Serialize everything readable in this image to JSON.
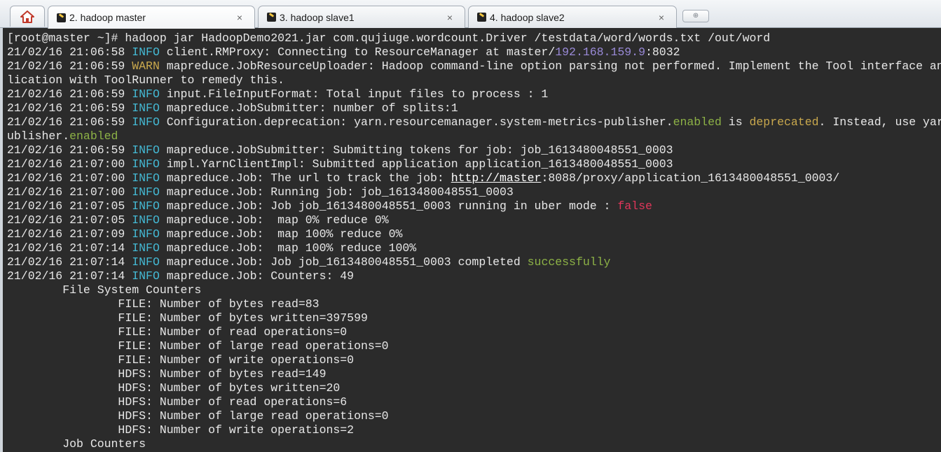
{
  "tabs": [
    {
      "label": "2. hadoop master",
      "active": true,
      "close": "×"
    },
    {
      "label": "3. hadoop slave1",
      "active": false,
      "close": "×"
    },
    {
      "label": "4. hadoop slave2",
      "active": false,
      "close": "×"
    }
  ],
  "new_tab_symbol": "⊕",
  "colors": {
    "background": "#2b2b2b",
    "text": "#e8e8e8",
    "info": "#44b9d4",
    "warn": "#c9a84d",
    "ip": "#9a8ad8",
    "highlight_green": "#8db246",
    "highlight_red": "#e0365a"
  },
  "terminal": {
    "lines": [
      [
        {
          "t": "[root@master ~]# hadoop jar HadoopDemo2021.jar com.qujiuge.wordcount.Driver /testdata/word/words.txt /out/word"
        }
      ],
      [
        {
          "t": "21/02/16 21:06:58 "
        },
        {
          "t": "INFO",
          "c": "info"
        },
        {
          "t": " client.RMProxy: Connecting to ResourceManager at master/"
        },
        {
          "t": "192.168.159.9",
          "c": "ip"
        },
        {
          "t": ":8032"
        }
      ],
      [
        {
          "t": "21/02/16 21:06:59 "
        },
        {
          "t": "WARN",
          "c": "warn"
        },
        {
          "t": " mapreduce.JobResourceUploader: Hadoop command-line option parsing not performed. Implement the Tool interface and execute your app"
        }
      ],
      [
        {
          "t": "lication with ToolRunner to remedy this."
        }
      ],
      [
        {
          "t": "21/02/16 21:06:59 "
        },
        {
          "t": "INFO",
          "c": "info"
        },
        {
          "t": " input.FileInputFormat: Total input files to process : 1"
        }
      ],
      [
        {
          "t": "21/02/16 21:06:59 "
        },
        {
          "t": "INFO",
          "c": "info"
        },
        {
          "t": " mapreduce.JobSubmitter: number of splits:1"
        }
      ],
      [
        {
          "t": "21/02/16 21:06:59 "
        },
        {
          "t": "INFO",
          "c": "info"
        },
        {
          "t": " Configuration.deprecation: yarn.resourcemanager.system-metrics-publisher."
        },
        {
          "t": "enabled",
          "c": "green"
        },
        {
          "t": " is "
        },
        {
          "t": "deprecated",
          "c": "warn"
        },
        {
          "t": ". Instead, use yarn.system-metrics-p"
        }
      ],
      [
        {
          "t": "ublisher."
        },
        {
          "t": "enabled",
          "c": "green"
        }
      ],
      [
        {
          "t": "21/02/16 21:06:59 "
        },
        {
          "t": "INFO",
          "c": "info"
        },
        {
          "t": " mapreduce.JobSubmitter: Submitting tokens for job: job_1613480048551_0003"
        }
      ],
      [
        {
          "t": "21/02/16 21:07:00 "
        },
        {
          "t": "INFO",
          "c": "info"
        },
        {
          "t": " impl.YarnClientImpl: Submitted application application_1613480048551_0003"
        }
      ],
      [
        {
          "t": "21/02/16 21:07:00 "
        },
        {
          "t": "INFO",
          "c": "info"
        },
        {
          "t": " mapreduce.Job: The url to track the job: "
        },
        {
          "t": "http://master",
          "c": "link"
        },
        {
          "t": ":8088/proxy/application_1613480048551_0003/"
        }
      ],
      [
        {
          "t": "21/02/16 21:07:00 "
        },
        {
          "t": "INFO",
          "c": "info"
        },
        {
          "t": " mapreduce.Job: Running job: job_1613480048551_0003"
        }
      ],
      [
        {
          "t": "21/02/16 21:07:05 "
        },
        {
          "t": "INFO",
          "c": "info"
        },
        {
          "t": " mapreduce.Job: Job job_1613480048551_0003 running in uber mode : "
        },
        {
          "t": "false",
          "c": "red"
        }
      ],
      [
        {
          "t": "21/02/16 21:07:05 "
        },
        {
          "t": "INFO",
          "c": "info"
        },
        {
          "t": " mapreduce.Job:  map 0% reduce 0%"
        }
      ],
      [
        {
          "t": "21/02/16 21:07:09 "
        },
        {
          "t": "INFO",
          "c": "info"
        },
        {
          "t": " mapreduce.Job:  map 100% reduce 0%"
        }
      ],
      [
        {
          "t": "21/02/16 21:07:14 "
        },
        {
          "t": "INFO",
          "c": "info"
        },
        {
          "t": " mapreduce.Job:  map 100% reduce 100%"
        }
      ],
      [
        {
          "t": "21/02/16 21:07:14 "
        },
        {
          "t": "INFO",
          "c": "info"
        },
        {
          "t": " mapreduce.Job: Job job_1613480048551_0003 completed "
        },
        {
          "t": "successfully",
          "c": "green"
        }
      ],
      [
        {
          "t": "21/02/16 21:07:14 "
        },
        {
          "t": "INFO",
          "c": "info"
        },
        {
          "t": " mapreduce.Job: Counters: 49"
        }
      ],
      [
        {
          "t": "\tFile System Counters"
        }
      ],
      [
        {
          "t": "\t\tFILE: Number of bytes read=83"
        }
      ],
      [
        {
          "t": "\t\tFILE: Number of bytes written=397599"
        }
      ],
      [
        {
          "t": "\t\tFILE: Number of read operations=0"
        }
      ],
      [
        {
          "t": "\t\tFILE: Number of large read operations=0"
        }
      ],
      [
        {
          "t": "\t\tFILE: Number of write operations=0"
        }
      ],
      [
        {
          "t": "\t\tHDFS: Number of bytes read=149"
        }
      ],
      [
        {
          "t": "\t\tHDFS: Number of bytes written=20"
        }
      ],
      [
        {
          "t": "\t\tHDFS: Number of read operations=6"
        }
      ],
      [
        {
          "t": "\t\tHDFS: Number of large read operations=0"
        }
      ],
      [
        {
          "t": "\t\tHDFS: Number of write operations=2"
        }
      ],
      [
        {
          "t": "\tJob Counters"
        }
      ]
    ]
  }
}
